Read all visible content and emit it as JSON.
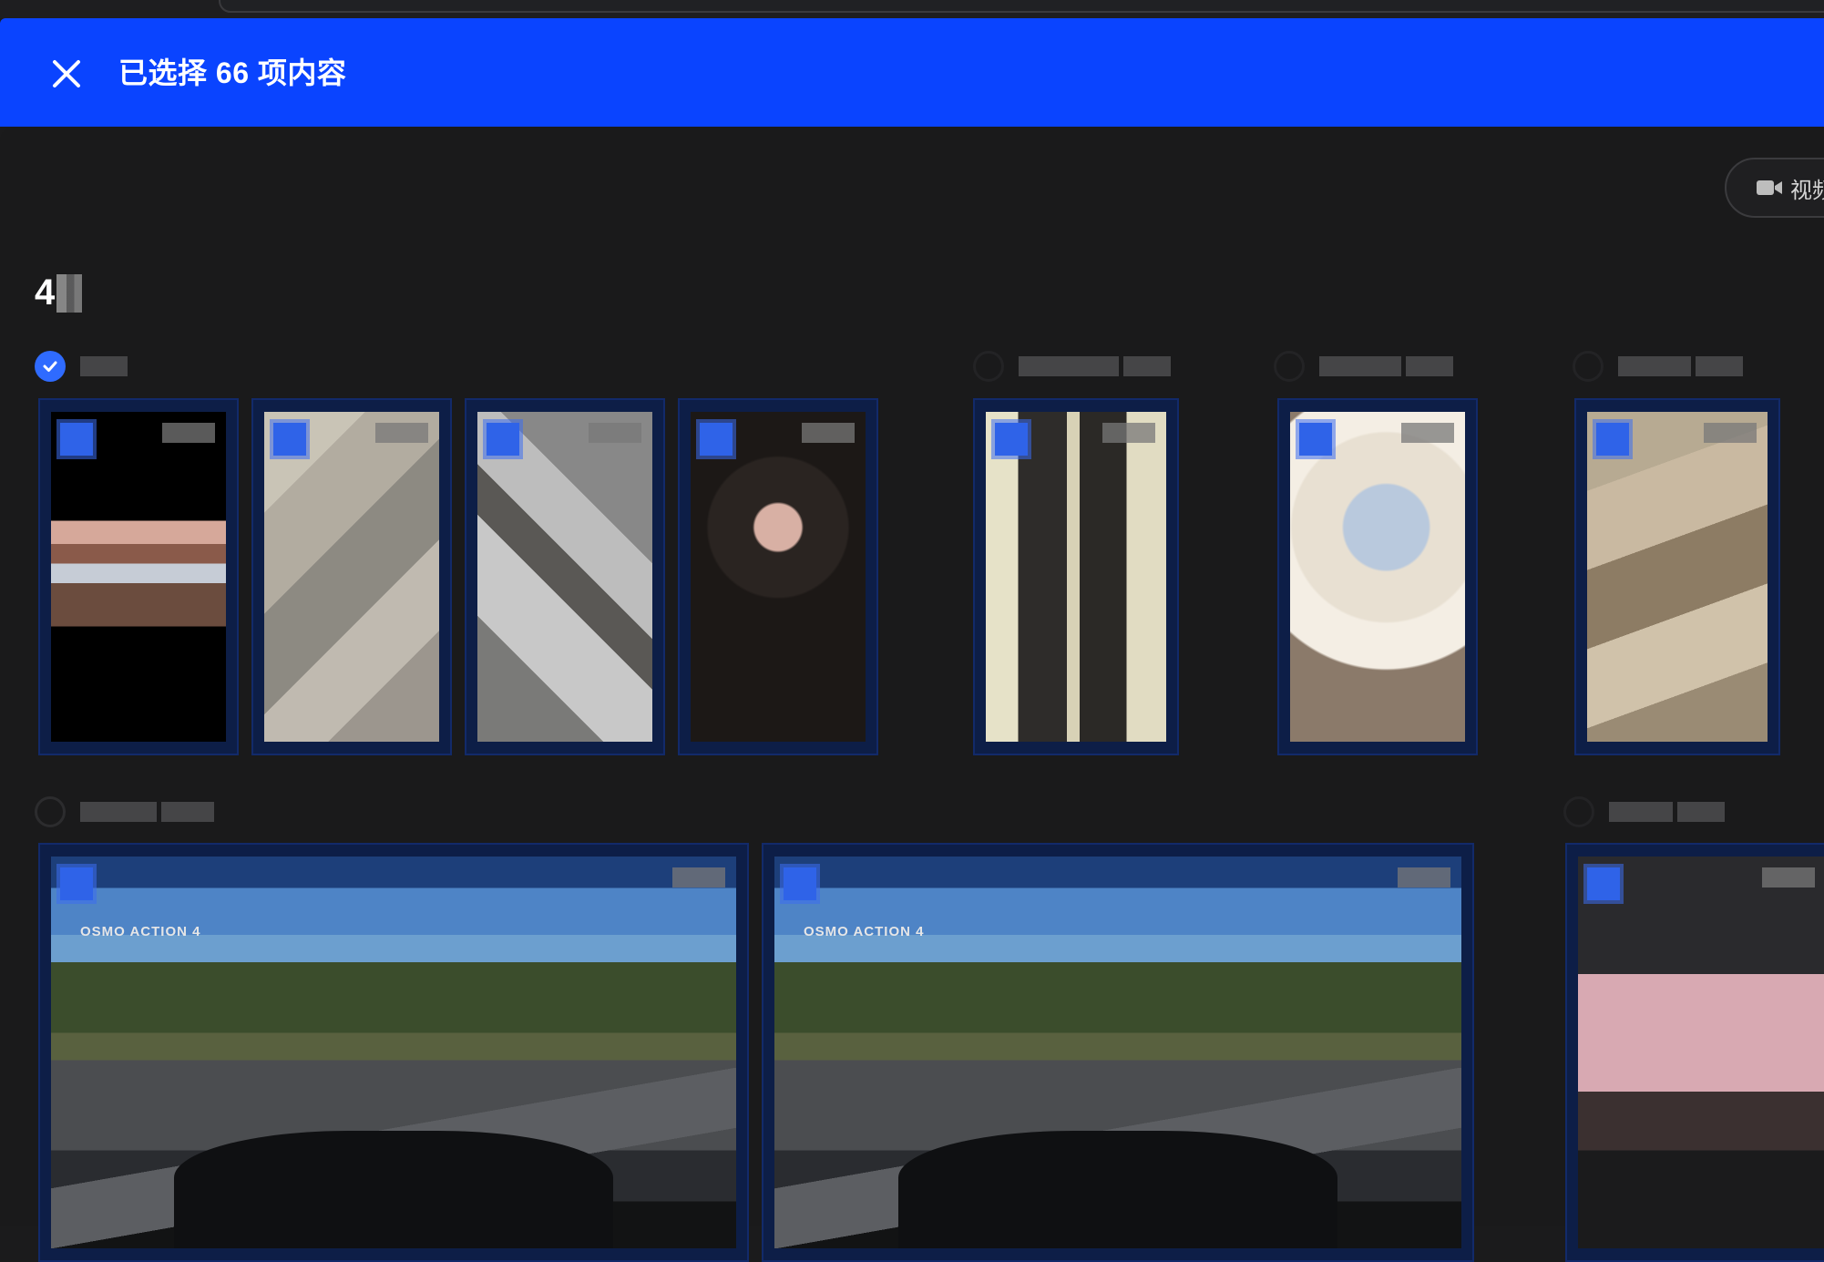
{
  "selection_bar": {
    "title": "已选择 66 项内容",
    "accent": "#0a44ff"
  },
  "filter": {
    "icon": "video-camera-icon",
    "label": "视频"
  },
  "month_heading": "4",
  "groups": [
    {
      "checked": true,
      "tiles": 4
    },
    {
      "checked": false,
      "tiles": 1
    },
    {
      "checked": false,
      "tiles": 1
    },
    {
      "checked": false,
      "tiles": 1
    },
    {
      "checked": false,
      "tiles": 2
    },
    {
      "checked": false,
      "tiles": 1
    }
  ],
  "watermark": "OSMO ACTION 4"
}
